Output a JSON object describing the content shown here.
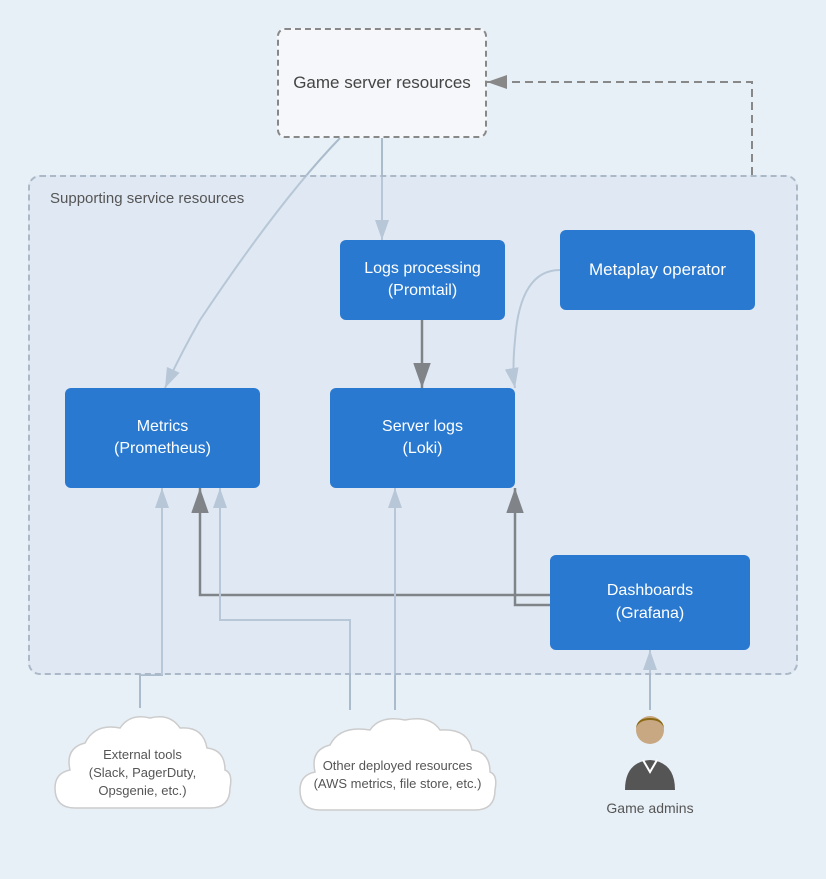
{
  "diagram": {
    "background_color": "#e8f0f7",
    "game_server_box": {
      "label": "Game server\nresources",
      "style": "dashed"
    },
    "supporting_box": {
      "label": "Supporting service resources"
    },
    "blue_boxes": {
      "logs_processing": {
        "label": "Logs processing\n(Promtail)"
      },
      "metaplay_operator": {
        "label": "Metaplay operator"
      },
      "metrics": {
        "label": "Metrics\n(Prometheus)"
      },
      "server_logs": {
        "label": "Server logs\n(Loki)"
      },
      "dashboards": {
        "label": "Dashboards\n(Grafana)"
      }
    },
    "cloud_boxes": {
      "external_tools": {
        "label": "External tools\n(Slack, PagerDuty,\nOpsgenie, etc.)"
      },
      "other_deployed": {
        "label": "Other deployed resources\n(AWS metrics, file store, etc.)"
      }
    },
    "game_admins": {
      "label": "Game admins"
    }
  }
}
